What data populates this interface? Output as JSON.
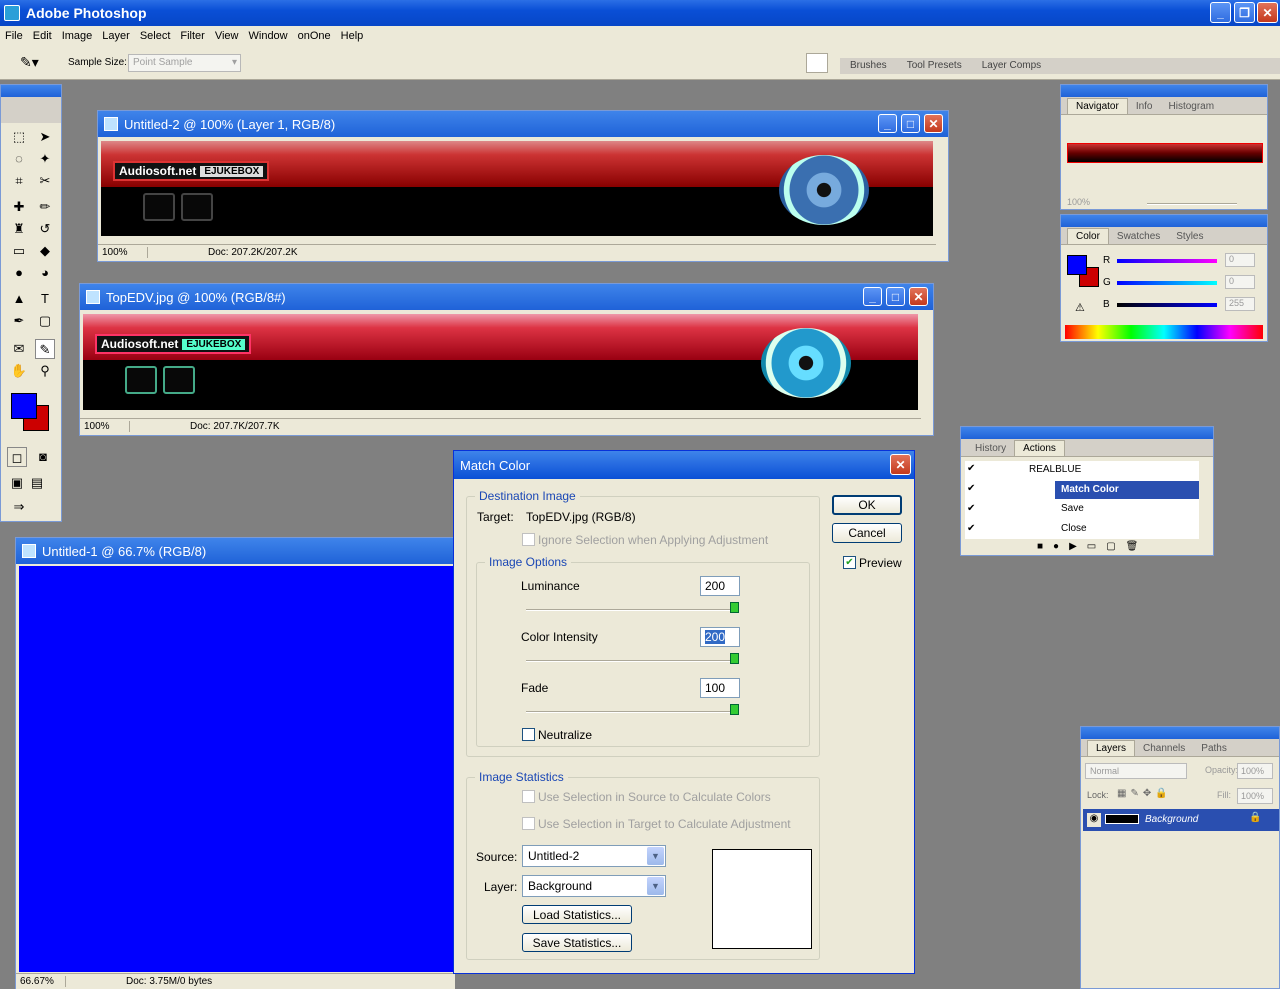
{
  "app": {
    "title": "Adobe Photoshop"
  },
  "menu": [
    "File",
    "Edit",
    "Image",
    "Layer",
    "Select",
    "Filter",
    "View",
    "Window",
    "onOne",
    "Help"
  ],
  "options": {
    "sample_size_label": "Sample Size:",
    "sample_size_value": "Point Sample"
  },
  "palette_well": {
    "tabs": [
      "Brushes",
      "Tool Presets",
      "Layer Comps"
    ]
  },
  "doc1": {
    "title": "Untitled-2 @ 100% (Layer 1, RGB/8)",
    "zoom": "100%",
    "doc": "Doc: 207.2K/207.2K",
    "logo": "Audiosoft.net",
    "logo_tag": "EJUKEBOX"
  },
  "doc2": {
    "title": "TopEDV.jpg @ 100% (RGB/8#)",
    "zoom": "100%",
    "doc": "Doc: 207.7K/207.7K",
    "logo": "Audiosoft.net",
    "logo_tag": "EJUKEBOX"
  },
  "doc3": {
    "title": "Untitled-1 @ 66.7% (RGB/8)",
    "zoom": "66.67%",
    "doc": "Doc: 3.75M/0 bytes",
    "fill": "#0000ff"
  },
  "navigator": {
    "tabs": [
      "Navigator",
      "Info",
      "Histogram"
    ],
    "zoom": "100%"
  },
  "color_panel": {
    "tabs": [
      "Color",
      "Swatches",
      "Styles"
    ],
    "r_label": "R",
    "g_label": "G",
    "b_label": "B",
    "r": "0",
    "g": "0",
    "b": "255"
  },
  "actions_panel": {
    "tabs": [
      "History",
      "Actions"
    ],
    "items": [
      "REALBLUE",
      "Match Color",
      "Save",
      "Close"
    ]
  },
  "layers_panel": {
    "tabs": [
      "Layers",
      "Channels",
      "Paths"
    ],
    "blend": "Normal",
    "opacity_label": "Opacity:",
    "opacity": "100%",
    "lock_label": "Lock:",
    "fill_label": "Fill:",
    "fill": "100%",
    "layer_name": "Background"
  },
  "dialog": {
    "title": "Match Color",
    "ok": "OK",
    "cancel": "Cancel",
    "preview": "Preview",
    "dest_legend": "Destination Image",
    "target_label": "Target:",
    "target_value": "TopEDV.jpg (RGB/8)",
    "ignore_sel": "Ignore Selection when Applying Adjustment",
    "options_legend": "Image Options",
    "luminance_label": "Luminance",
    "luminance": "200",
    "intensity_label": "Color Intensity",
    "intensity": "200",
    "fade_label": "Fade",
    "fade": "100",
    "neutralize": "Neutralize",
    "stats_legend": "Image Statistics",
    "use_src": "Use Selection in Source to Calculate Colors",
    "use_tgt": "Use Selection in Target to Calculate Adjustment",
    "source_label": "Source:",
    "source_value": "Untitled-2",
    "layer_label": "Layer:",
    "layer_value": "Background",
    "load_stats": "Load Statistics...",
    "save_stats": "Save Statistics..."
  },
  "colors": {
    "foreground": "#0000ff",
    "background": "#cc0000",
    "accent": "#0a4fd6"
  }
}
